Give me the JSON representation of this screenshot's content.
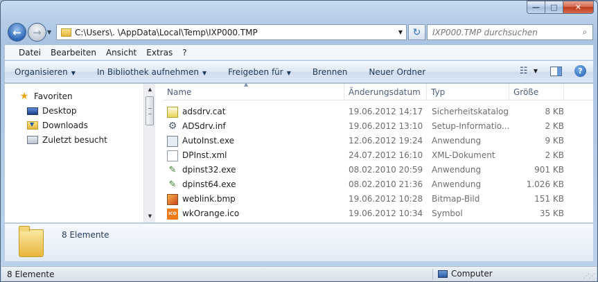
{
  "window": {
    "min_glyph": "—",
    "max_glyph": "□",
    "close_glyph": "✕"
  },
  "nav": {
    "back_glyph": "←",
    "forward_glyph": "→",
    "dropdown_glyph": "▼"
  },
  "address": {
    "path": "C:\\Users\\.          \\AppData\\Local\\Temp\\IXP000.TMP",
    "dropdown_glyph": "▼"
  },
  "refresh_glyph": "↻",
  "search": {
    "placeholder": "IXP000.TMP durchsuchen",
    "icon_glyph": "⌕"
  },
  "menu": [
    {
      "label": "Datei"
    },
    {
      "label": "Bearbeiten"
    },
    {
      "label": "Ansicht"
    },
    {
      "label": "Extras"
    },
    {
      "label": "?"
    }
  ],
  "toolbar": {
    "organize": "Organisieren",
    "library": "In Bibliothek aufnehmen",
    "share": "Freigeben für",
    "burn": "Brennen",
    "new_folder": "Neuer Ordner",
    "arrow_glyph": "▼",
    "views_glyph": "☷",
    "help_glyph": "?"
  },
  "sidebar": {
    "favorites": "Favoriten",
    "items": [
      {
        "label": "Desktop"
      },
      {
        "label": "Downloads"
      },
      {
        "label": "Zuletzt besucht"
      }
    ]
  },
  "columns": {
    "name": "Name",
    "date": "Änderungsdatum",
    "type": "Typ",
    "size": "Größe",
    "sort_glyph": "▲"
  },
  "files": [
    {
      "name": "adsdrv.cat",
      "date": "19.06.2012 14:17",
      "type": "Sicherheitskatalog",
      "size": "8 KB",
      "icon": "catalog-file-icon"
    },
    {
      "name": "ADSdrv.inf",
      "date": "19.06.2012 13:10",
      "type": "Setup-Informatio...",
      "size": "2 KB",
      "icon": "setup-info-file-icon"
    },
    {
      "name": "AutoInst.exe",
      "date": "12.06.2012 19:24",
      "type": "Anwendung",
      "size": "9 KB",
      "icon": "application-file-icon"
    },
    {
      "name": "DPInst.xml",
      "date": "24.07.2012 16:10",
      "type": "XML-Dokument",
      "size": "2 KB",
      "icon": "xml-file-icon"
    },
    {
      "name": "dpinst32.exe",
      "date": "08.02.2010 20:59",
      "type": "Anwendung",
      "size": "901 KB",
      "icon": "driver-installer-icon"
    },
    {
      "name": "dpinst64.exe",
      "date": "08.02.2010 21:36",
      "type": "Anwendung",
      "size": "1.026 KB",
      "icon": "driver-installer-icon"
    },
    {
      "name": "weblink.bmp",
      "date": "19.06.2012 10:28",
      "type": "Bitmap-Bild",
      "size": "151 KB",
      "icon": "bitmap-file-icon"
    },
    {
      "name": "wkOrange.ico",
      "date": "19.06.2012 10:34",
      "type": "Symbol",
      "size": "35 KB",
      "icon": "icon-file-icon"
    }
  ],
  "details": {
    "count": "8 Elemente"
  },
  "status": {
    "left": "8 Elemente",
    "right": "Computer"
  },
  "colors": {
    "accent": "#1e395b",
    "close": "#c0391c"
  }
}
